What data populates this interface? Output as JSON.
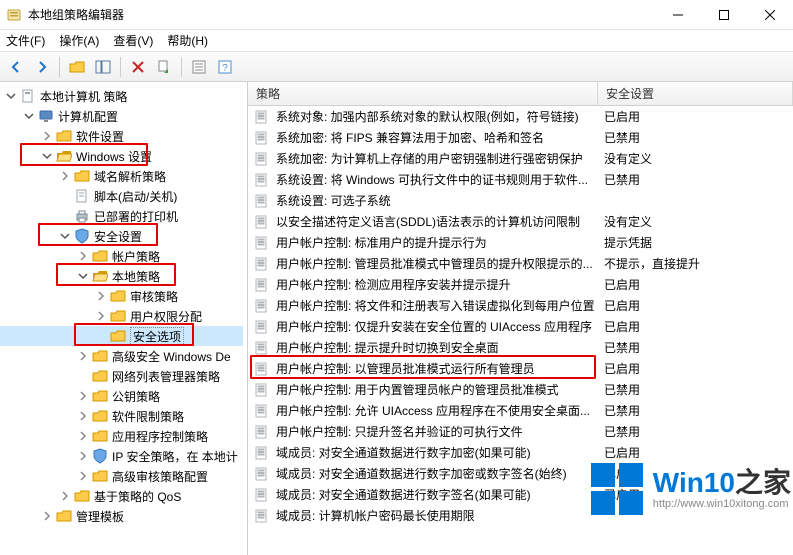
{
  "window": {
    "title": "本地组策略编辑器"
  },
  "menu": [
    "文件(F)",
    "操作(A)",
    "查看(V)",
    "帮助(H)"
  ],
  "tree": {
    "root": "本地计算机 策略",
    "items": [
      {
        "depth": 1,
        "grip": "v",
        "icon": "computer",
        "label": "计算机配置"
      },
      {
        "depth": 2,
        "grip": ">",
        "icon": "folder",
        "label": "软件设置"
      },
      {
        "depth": 2,
        "grip": "v",
        "icon": "folder-open",
        "label": "Windows 设置",
        "hl": true
      },
      {
        "depth": 3,
        "grip": ">",
        "icon": "folder",
        "label": "域名解析策略"
      },
      {
        "depth": 3,
        "grip": "",
        "icon": "doc",
        "label": "脚本(启动/关机)"
      },
      {
        "depth": 3,
        "grip": "",
        "icon": "printer",
        "label": "已部署的打印机"
      },
      {
        "depth": 3,
        "grip": "v",
        "icon": "shield",
        "label": "安全设置",
        "hl": true
      },
      {
        "depth": 4,
        "grip": ">",
        "icon": "folder",
        "label": "帐户策略"
      },
      {
        "depth": 4,
        "grip": "v",
        "icon": "folder-open",
        "label": "本地策略",
        "hl": true
      },
      {
        "depth": 5,
        "grip": ">",
        "icon": "folder",
        "label": "审核策略"
      },
      {
        "depth": 5,
        "grip": ">",
        "icon": "folder",
        "label": "用户权限分配"
      },
      {
        "depth": 5,
        "grip": "",
        "icon": "folder",
        "label": "安全选项",
        "hl": true,
        "selected": true
      },
      {
        "depth": 4,
        "grip": ">",
        "icon": "folder",
        "label": "高级安全 Windows De"
      },
      {
        "depth": 4,
        "grip": "",
        "icon": "folder",
        "label": "网络列表管理器策略"
      },
      {
        "depth": 4,
        "grip": ">",
        "icon": "folder",
        "label": "公钥策略"
      },
      {
        "depth": 4,
        "grip": ">",
        "icon": "folder",
        "label": "软件限制策略"
      },
      {
        "depth": 4,
        "grip": ">",
        "icon": "folder",
        "label": "应用程序控制策略"
      },
      {
        "depth": 4,
        "grip": ">",
        "icon": "shield",
        "label": "IP 安全策略，在 本地计"
      },
      {
        "depth": 4,
        "grip": ">",
        "icon": "folder",
        "label": "高级审核策略配置"
      },
      {
        "depth": 3,
        "grip": ">",
        "icon": "folder",
        "label": "基于策略的 QoS"
      },
      {
        "depth": 2,
        "grip": ">",
        "icon": "folder",
        "label": "管理模板"
      }
    ]
  },
  "columns": {
    "policy": "策略",
    "setting": "安全设置"
  },
  "rows": [
    {
      "policy": "系统对象: 加强内部系统对象的默认权限(例如，符号链接)",
      "setting": "已启用"
    },
    {
      "policy": "系统加密: 将 FIPS 兼容算法用于加密、哈希和签名",
      "setting": "已禁用"
    },
    {
      "policy": "系统加密: 为计算机上存储的用户密钥强制进行强密钥保护",
      "setting": "没有定义"
    },
    {
      "policy": "系统设置: 将 Windows 可执行文件中的证书规则用于软件...",
      "setting": "已禁用"
    },
    {
      "policy": "系统设置: 可选子系统",
      "setting": ""
    },
    {
      "policy": "以安全描述符定义语言(SDDL)语法表示的计算机访问限制",
      "setting": "没有定义"
    },
    {
      "policy": "用户帐户控制: 标准用户的提升提示行为",
      "setting": "提示凭据"
    },
    {
      "policy": "用户帐户控制: 管理员批准模式中管理员的提升权限提示的...",
      "setting": "不提示，直接提升"
    },
    {
      "policy": "用户帐户控制: 检测应用程序安装并提示提升",
      "setting": "已启用"
    },
    {
      "policy": "用户帐户控制: 将文件和注册表写入错误虚拟化到每用户位置",
      "setting": "已启用"
    },
    {
      "policy": "用户帐户控制: 仅提升安装在安全位置的 UIAccess 应用程序",
      "setting": "已启用"
    },
    {
      "policy": "用户帐户控制: 提示提升时切换到安全桌面",
      "setting": "已禁用"
    },
    {
      "policy": "用户帐户控制: 以管理员批准模式运行所有管理员",
      "setting": "已启用",
      "hl": true
    },
    {
      "policy": "用户帐户控制: 用于内置管理员帐户的管理员批准模式",
      "setting": "已禁用"
    },
    {
      "policy": "用户帐户控制: 允许 UIAccess 应用程序在不使用安全桌面...",
      "setting": "已禁用"
    },
    {
      "policy": "用户帐户控制: 只提升签名并验证的可执行文件",
      "setting": "已禁用"
    },
    {
      "policy": "域成员: 对安全通道数据进行数字加密(如果可能)",
      "setting": "已启用"
    },
    {
      "policy": "域成员: 对安全通道数据进行数字加密或数字签名(始终)",
      "setting": "已启用"
    },
    {
      "policy": "域成员: 对安全通道数据进行数字签名(如果可能)",
      "setting": "已启用"
    },
    {
      "policy": "域成员: 计算机帐户密码最长使用期限",
      "setting": ""
    }
  ],
  "watermark": {
    "brand_prefix": "Win10",
    "brand_suffix": "之家",
    "url": "http://www.win10xitong.com"
  }
}
